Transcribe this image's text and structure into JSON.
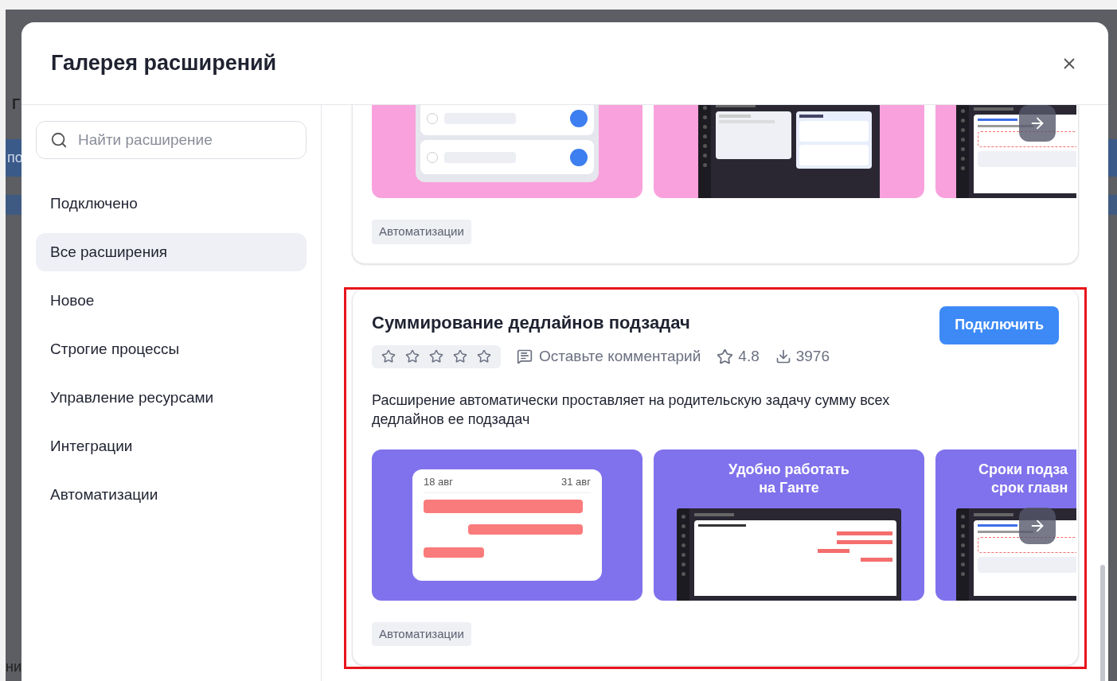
{
  "backdrop": {
    "fragments": [
      "Г",
      "по",
      "ни"
    ]
  },
  "dialog": {
    "title": "Галерея расширений"
  },
  "sidebar": {
    "search": {
      "placeholder": "Найти расширение"
    },
    "items": [
      {
        "label": "Подключено",
        "selected": false
      },
      {
        "label": "Все расширения",
        "selected": true
      },
      {
        "label": "Новое",
        "selected": false
      },
      {
        "label": "Строгие процессы",
        "selected": false
      },
      {
        "label": "Управление ресурсами",
        "selected": false
      },
      {
        "label": "Интеграции",
        "selected": false
      },
      {
        "label": "Автоматизации",
        "selected": false
      }
    ]
  },
  "extensions": [
    {
      "kind": "partial",
      "images": [
        {
          "kind": "task-list",
          "color": "#f9a1dc"
        },
        {
          "kind": "board-screenshot",
          "color": "#f9a1dc"
        },
        {
          "kind": "form-screenshot",
          "color": "#f9a1dc"
        }
      ],
      "tag": "Автоматизации"
    },
    {
      "kind": "full",
      "highlighted": true,
      "title": "Суммирование дедлайнов подзадач",
      "stars": 0,
      "comment_link": "Оставьте комментарий",
      "rating": "4.8",
      "downloads": "3976",
      "connect_button": "Подключить",
      "description": "Расширение автоматически проставляет на родительскую задачу сумму всех дедлайнов ее подзадач",
      "images": [
        {
          "kind": "gantt-dates",
          "color": "#8072ec",
          "labels": [
            "18 авг",
            "31 авг"
          ]
        },
        {
          "kind": "caption-gantt",
          "color": "#8072ec",
          "caption_lines": [
            "Удобно работать",
            "на Ганте"
          ]
        },
        {
          "kind": "caption-tree",
          "color": "#8072ec",
          "caption_lines": [
            "Сроки подза",
            "срок главн"
          ]
        }
      ],
      "tag": "Автоматизации"
    }
  ]
}
